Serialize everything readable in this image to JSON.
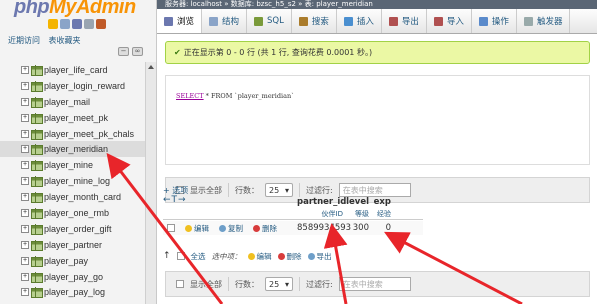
{
  "logo": {
    "part1": "php",
    "part2": "MyAdmin"
  },
  "nav_links": [
    "近期访问",
    "表收藏夹"
  ],
  "tables": [
    "player_life_card",
    "player_login_reward",
    "player_mail",
    "player_meet_pk",
    "player_meet_pk_chals",
    "player_meridian",
    "player_mine",
    "player_mine_log",
    "player_month_card",
    "player_one_rmb",
    "player_order_gift",
    "player_partner",
    "player_pay",
    "player_pay_go",
    "player_pay_log"
  ],
  "selected_table": "player_meridian",
  "breadcrumb": "服务器: localhost » 数据库: bzsc_h5_s2 » 表: player_meridian",
  "tabs": [
    {
      "label": "浏览",
      "icon": "browse-icon"
    },
    {
      "label": "结构",
      "icon": "structure-icon"
    },
    {
      "label": "SQL",
      "icon": "sql-icon"
    },
    {
      "label": "搜索",
      "icon": "search-icon"
    },
    {
      "label": "插入",
      "icon": "insert-icon"
    },
    {
      "label": "导出",
      "icon": "export-icon"
    },
    {
      "label": "导入",
      "icon": "import-icon"
    },
    {
      "label": "操作",
      "icon": "operations-icon"
    },
    {
      "label": "触发器",
      "icon": "triggers-icon"
    }
  ],
  "success_msg": "正在显示第 0 - 0 行 (共 1 行, 查询花费 0.0001 秒。)",
  "sql": {
    "keyword1": "SELECT",
    "rest": " * FROM `player_meridian`"
  },
  "nav_bar": {
    "show_all": "显示全部",
    "rows_label": "行数：",
    "rows_value": "25",
    "filter_label": "过滤行:",
    "filter_placeholder": "在表中搜索"
  },
  "options_link": "+ 选项",
  "sort_arrows": "←T→",
  "columns": [
    {
      "name": "partner_id",
      "comment": "伙伴ID"
    },
    {
      "name": "level",
      "comment": "等级"
    },
    {
      "name": "exp",
      "comment": "经验"
    }
  ],
  "row": {
    "edit": "编辑",
    "copy": "复制",
    "delete": "删除",
    "partner_id": "8589934593",
    "level": "300",
    "exp": "0"
  },
  "bulk": {
    "check_all": "全选",
    "with_selected": "选中项：",
    "edit": "编辑",
    "delete": "删除",
    "export": "导出"
  },
  "colors": {
    "accent_link": "#235a81",
    "success_bg": "#ebf8a4",
    "arrow": "#e8252a"
  }
}
